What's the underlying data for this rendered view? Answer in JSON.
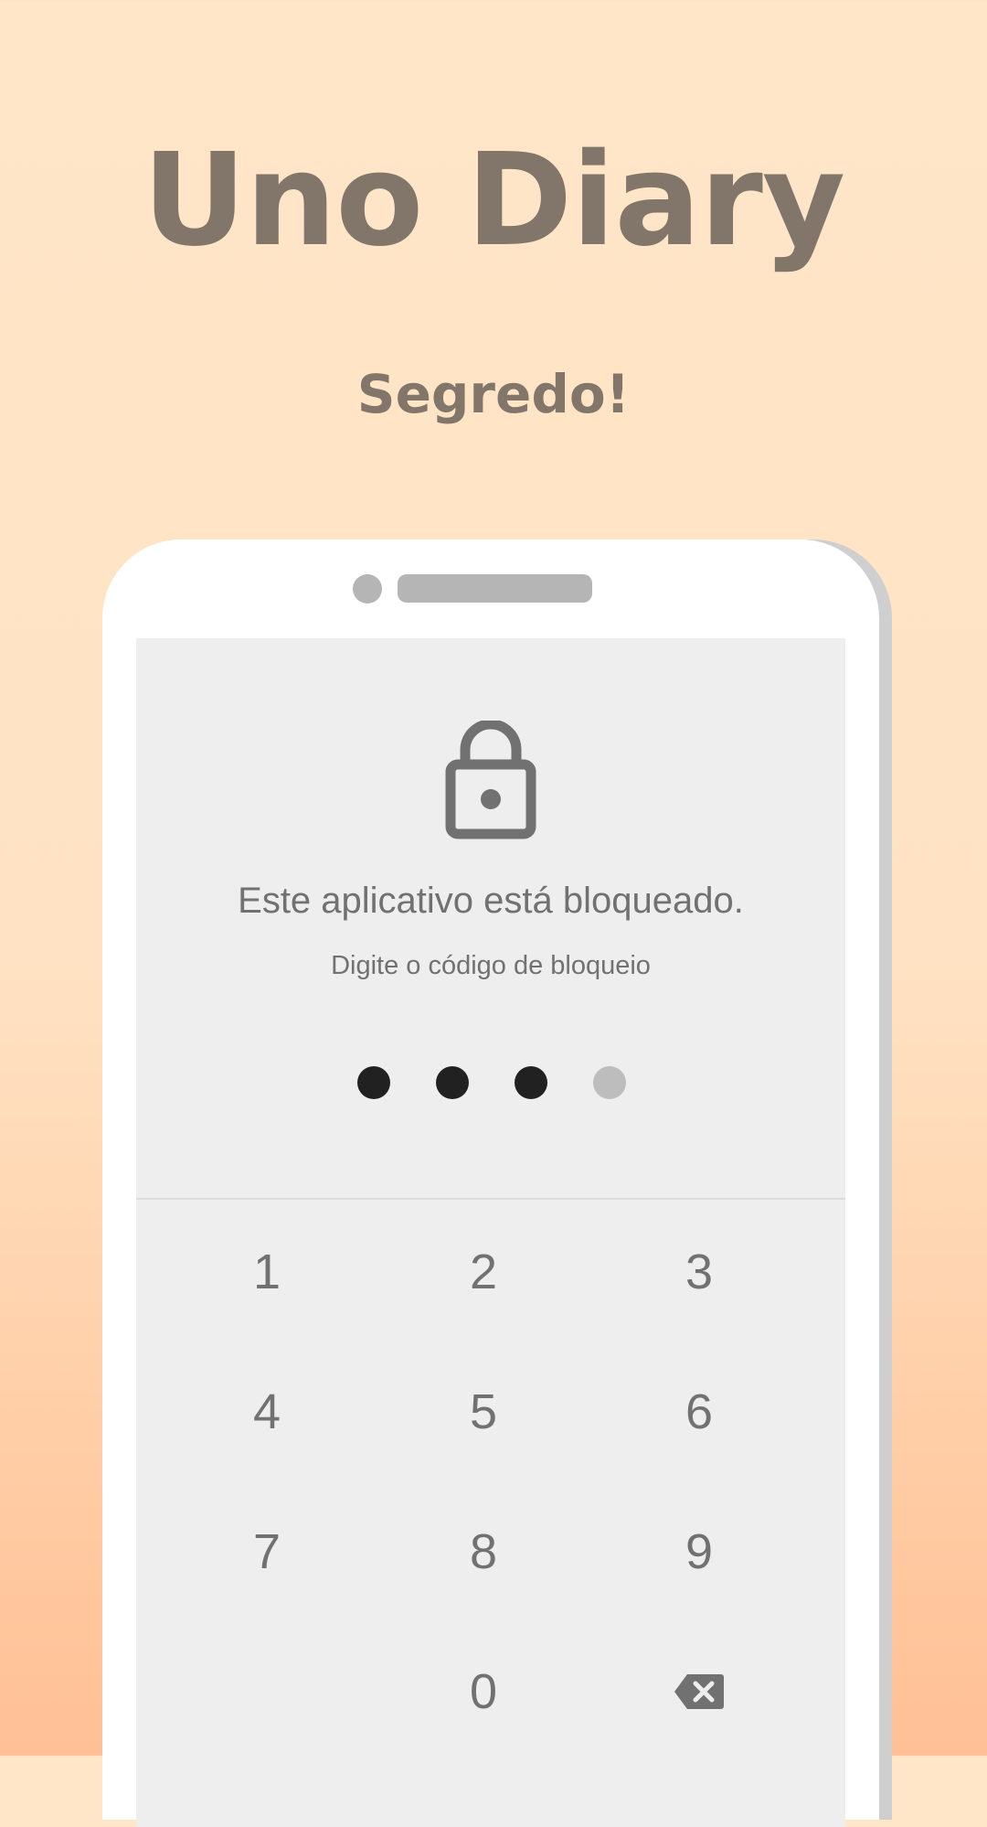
{
  "header": {
    "app_title": "Uno Diary",
    "subtitle": "Segredo!"
  },
  "lock_screen": {
    "icon": "lock-icon",
    "title": "Este aplicativo está bloqueado.",
    "prompt": "Digite o código de bloqueio",
    "pin_length": 4,
    "pin_filled": 3
  },
  "keypad": {
    "keys": [
      "1",
      "2",
      "3",
      "4",
      "5",
      "6",
      "7",
      "8",
      "9",
      "",
      "0"
    ],
    "delete_icon": "backspace-icon"
  },
  "colors": {
    "title_text": "#82766a",
    "screen_bg": "#eeeeee",
    "dot_filled": "#212121",
    "dot_empty": "#bdbdbd",
    "key_text": "#717171"
  }
}
